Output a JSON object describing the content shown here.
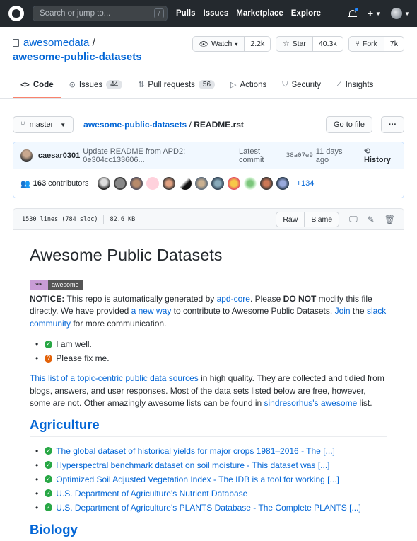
{
  "topbar": {
    "search_placeholder": "Search or jump to...",
    "search_shortcut": "/",
    "links": [
      "Pulls",
      "Issues",
      "Marketplace",
      "Explore"
    ]
  },
  "repo": {
    "owner": "awesomedata",
    "separator": "/",
    "name": "awesome-public-datasets",
    "watch_label": "Watch",
    "watch_count": "2.2k",
    "star_label": "Star",
    "star_count": "40.3k",
    "fork_label": "Fork",
    "fork_count": "7k"
  },
  "tabs": [
    {
      "label": "Code",
      "icon": "code-icon",
      "count": ""
    },
    {
      "label": "Issues",
      "icon": "issue-icon",
      "count": "44"
    },
    {
      "label": "Pull requests",
      "icon": "pull-request-icon",
      "count": "56"
    },
    {
      "label": "Actions",
      "icon": "play-icon",
      "count": ""
    },
    {
      "label": "Security",
      "icon": "shield-icon",
      "count": ""
    },
    {
      "label": "Insights",
      "icon": "graph-icon",
      "count": ""
    }
  ],
  "filenav": {
    "branch": "master",
    "crumb_repo": "awesome-public-datasets",
    "crumb_sep": "/",
    "crumb_file": "README.rst",
    "goto_file": "Go to file",
    "more": "···"
  },
  "commit": {
    "author": "caesar0301",
    "message": "Update README from APD2: 0e304cc133606...",
    "latest_label": "Latest commit",
    "sha": "38a07e9",
    "time": "11 days ago",
    "history": "History",
    "contributors_count": "163",
    "contributors_label": "contributors",
    "more_contributors": "+134"
  },
  "file": {
    "lines": "1530 lines (784 sloc)",
    "size": "82.6 KB",
    "raw": "Raw",
    "blame": "Blame"
  },
  "readme": {
    "title": "Awesome Public Datasets",
    "badge_text": "awesome",
    "notice_label": "NOTICE:",
    "notice_1": " This repo is automatically generated by ",
    "notice_link_1": "apd-core",
    "notice_2": ". Please ",
    "notice_bold": "DO NOT",
    "notice_3": " modify this file directly. We have provided ",
    "notice_link_2": "a new way",
    "notice_4": " to contribute to Awesome Public Datasets. ",
    "notice_link_3": "Join",
    "notice_5": " the ",
    "notice_link_4": "slack community",
    "notice_6": " for more communication.",
    "status_ok": "I am well.",
    "status_fix": "Please fix me.",
    "intro_link": "This list of a topic-centric public data sources",
    "intro_1": " in high quality. They are collected and tidied from blogs, answers, and user responses. Most of the data sets listed below are free, however, some are not. Other amazingly awesome lists can be found in ",
    "intro_link_2": "sindresorhus's awesome",
    "intro_2": " list.",
    "section_1": "Agriculture",
    "agriculture": [
      "The global dataset of historical yields for major crops 1981–2016 - The [...]",
      "Hyperspectral benchmark dataset on soil moisture - This dataset was [...]",
      "Optimized Soil Adjusted Vegetation Index - The IDB is a tool for working [...]",
      "U.S. Department of Agriculture's Nutrient Database",
      "U.S. Department of Agriculture's PLANTS Database - The Complete PLANTS [...]"
    ],
    "section_2": "Biology"
  },
  "colors": {
    "topbar": "#24292e",
    "link": "#0366d6",
    "active_tab": "#f9826c",
    "ok": "#28a745",
    "warn": "#e36209"
  }
}
